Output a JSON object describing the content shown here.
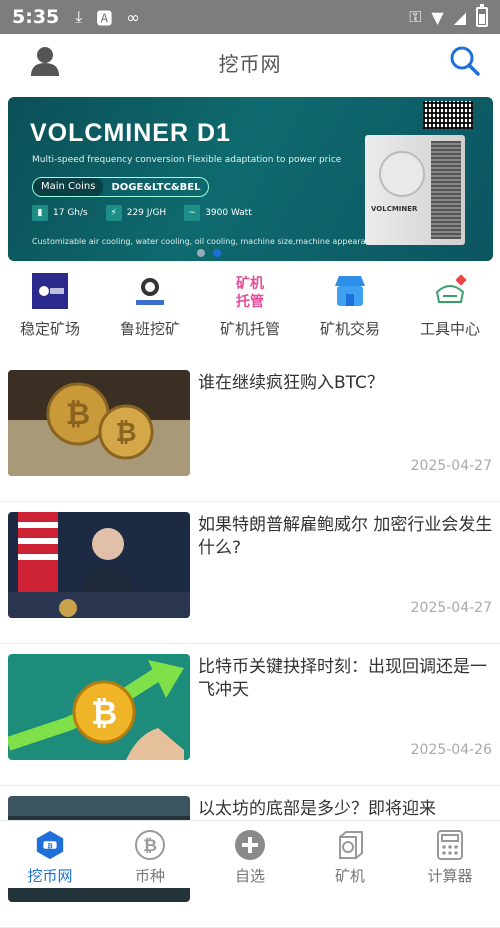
{
  "status_bar": {
    "time": "5:35"
  },
  "app_bar": {
    "title": "挖币网"
  },
  "banner": {
    "title": "VOLCMINER D1",
    "subtitle": "Multi-speed frequency conversion  Flexible adaptation to power price",
    "coins_label": "Main Coins",
    "coins_value": "DOGE&LTC&BEL",
    "specs": [
      "17 Gh/s",
      "229 J/GH",
      "3900 Watt"
    ],
    "footer": "Customizable air cooling, water cooling, oil cooling, machine size,machine appearance etc.",
    "miner_brand": "VOLCMINER",
    "dots": 2,
    "active_dot": 1
  },
  "shortcuts": [
    {
      "label": "稳定矿场",
      "icon": "mining-farm-logo-icon"
    },
    {
      "label": "鲁班挖矿",
      "icon": "luban-mining-logo-icon"
    },
    {
      "label": "矿机托管",
      "icon": "hosting-icon",
      "icon_text": "矿机托管"
    },
    {
      "label": "矿机交易",
      "icon": "store-icon"
    },
    {
      "label": "工具中心",
      "icon": "tools-icon"
    }
  ],
  "news": [
    {
      "title": "谁在继续疯狂购入BTC？",
      "date": "2025-04-27"
    },
    {
      "title": "如果特朗普解雇鲍威尔 加密行业会发生什么?",
      "date": "2025-04-27"
    },
    {
      "title": "比特币关键抉择时刻：出现回调还是一飞冲天",
      "date": "2025-04-26"
    },
    {
      "title": "以太坊的底部是多少？即将迎来",
      "date": ""
    }
  ],
  "tabbar": {
    "tabs": [
      {
        "label": "挖币网",
        "icon": "mining-chip-icon",
        "active": true
      },
      {
        "label": "币种",
        "icon": "bitcoin-icon",
        "active": false
      },
      {
        "label": "自选",
        "icon": "add-circle-icon",
        "active": false
      },
      {
        "label": "矿机",
        "icon": "miner-box-icon",
        "active": false
      },
      {
        "label": "计算器",
        "icon": "calculator-icon",
        "active": false
      }
    ]
  },
  "colors": {
    "accent": "#1e6fd9",
    "status_bar": "#7d7d7d",
    "banner_bg": "#0e6a6e"
  }
}
